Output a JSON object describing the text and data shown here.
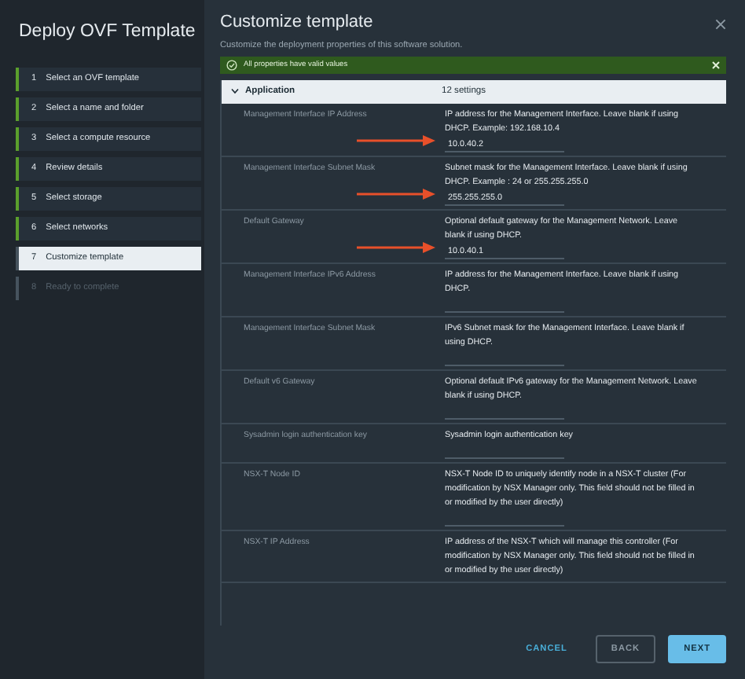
{
  "dialog": {
    "title": "Deploy OVF Template"
  },
  "steps": [
    {
      "number": "1",
      "label": "Select an OVF template",
      "completed": true,
      "selected": false,
      "disabled": false
    },
    {
      "number": "2",
      "label": "Select a name and folder",
      "completed": true,
      "selected": false,
      "disabled": false
    },
    {
      "number": "3",
      "label": "Select a compute resource",
      "completed": true,
      "selected": false,
      "disabled": false
    },
    {
      "number": "4",
      "label": "Review details",
      "completed": true,
      "selected": false,
      "disabled": false
    },
    {
      "number": "5",
      "label": "Select storage",
      "completed": true,
      "selected": false,
      "disabled": false
    },
    {
      "number": "6",
      "label": "Select networks",
      "completed": true,
      "selected": false,
      "disabled": false
    },
    {
      "number": "7",
      "label": "Customize template",
      "completed": false,
      "selected": true,
      "disabled": false
    },
    {
      "number": "8",
      "label": "Ready to complete",
      "completed": false,
      "selected": false,
      "disabled": true
    }
  ],
  "page": {
    "title": "Customize template",
    "subtitle": "Customize the deployment properties of this software solution."
  },
  "alert": {
    "text": "All properties have valid values"
  },
  "section": {
    "name": "Application",
    "count": "12 settings",
    "expanded": true
  },
  "properties": [
    {
      "label": "Management Interface IP Address",
      "description": "IP address for the Management Interface. Leave blank if using DHCP. Example: 192.168.10.4",
      "field": true,
      "value": "10.0.40.2",
      "annotated": true
    },
    {
      "label": "Management Interface Subnet Mask",
      "description": "Subnet mask for the Management Interface. Leave blank if using DHCP. Example : 24 or 255.255.255.0",
      "field": true,
      "value": "255.255.255.0",
      "annotated": true
    },
    {
      "label": "Default Gateway",
      "description": "Optional default gateway for the Management Network. Leave blank if using DHCP.",
      "field": true,
      "value": "10.0.40.1",
      "annotated": true
    },
    {
      "label": "Management Interface IPv6 Address",
      "description": "IP address for the Management Interface. Leave blank if using DHCP.",
      "field": true,
      "annotated": false
    },
    {
      "label": "Management Interface Subnet Mask",
      "description": "IPv6 Subnet mask for the Management Interface. Leave blank if using DHCP.",
      "field": true,
      "annotated": false
    },
    {
      "label": "Default v6 Gateway",
      "description": "Optional default IPv6 gateway for the Management Network. Leave blank if using DHCP.",
      "field": true,
      "annotated": false
    },
    {
      "label": "Sysadmin login authentication key",
      "description": "Sysadmin login authentication key",
      "field": true,
      "annotated": false
    },
    {
      "label": "NSX-T Node ID",
      "description": "NSX-T Node ID to uniquely identify node in a NSX-T cluster (For modification by NSX Manager only. This field should not be filled in or modified by the user directly)",
      "field": true,
      "annotated": false
    },
    {
      "label": "NSX-T IP Address",
      "description": "IP address of the NSX-T which will manage this controller (For modification by NSX Manager only. This field should not be filled in or modified by the user directly)",
      "field": false,
      "annotated": false
    }
  ],
  "buttons": [
    {
      "label": "CANCEL",
      "kind": "link"
    },
    {
      "label": "BACK",
      "kind": "outline"
    },
    {
      "label": "NEXT",
      "kind": "primary"
    }
  ]
}
